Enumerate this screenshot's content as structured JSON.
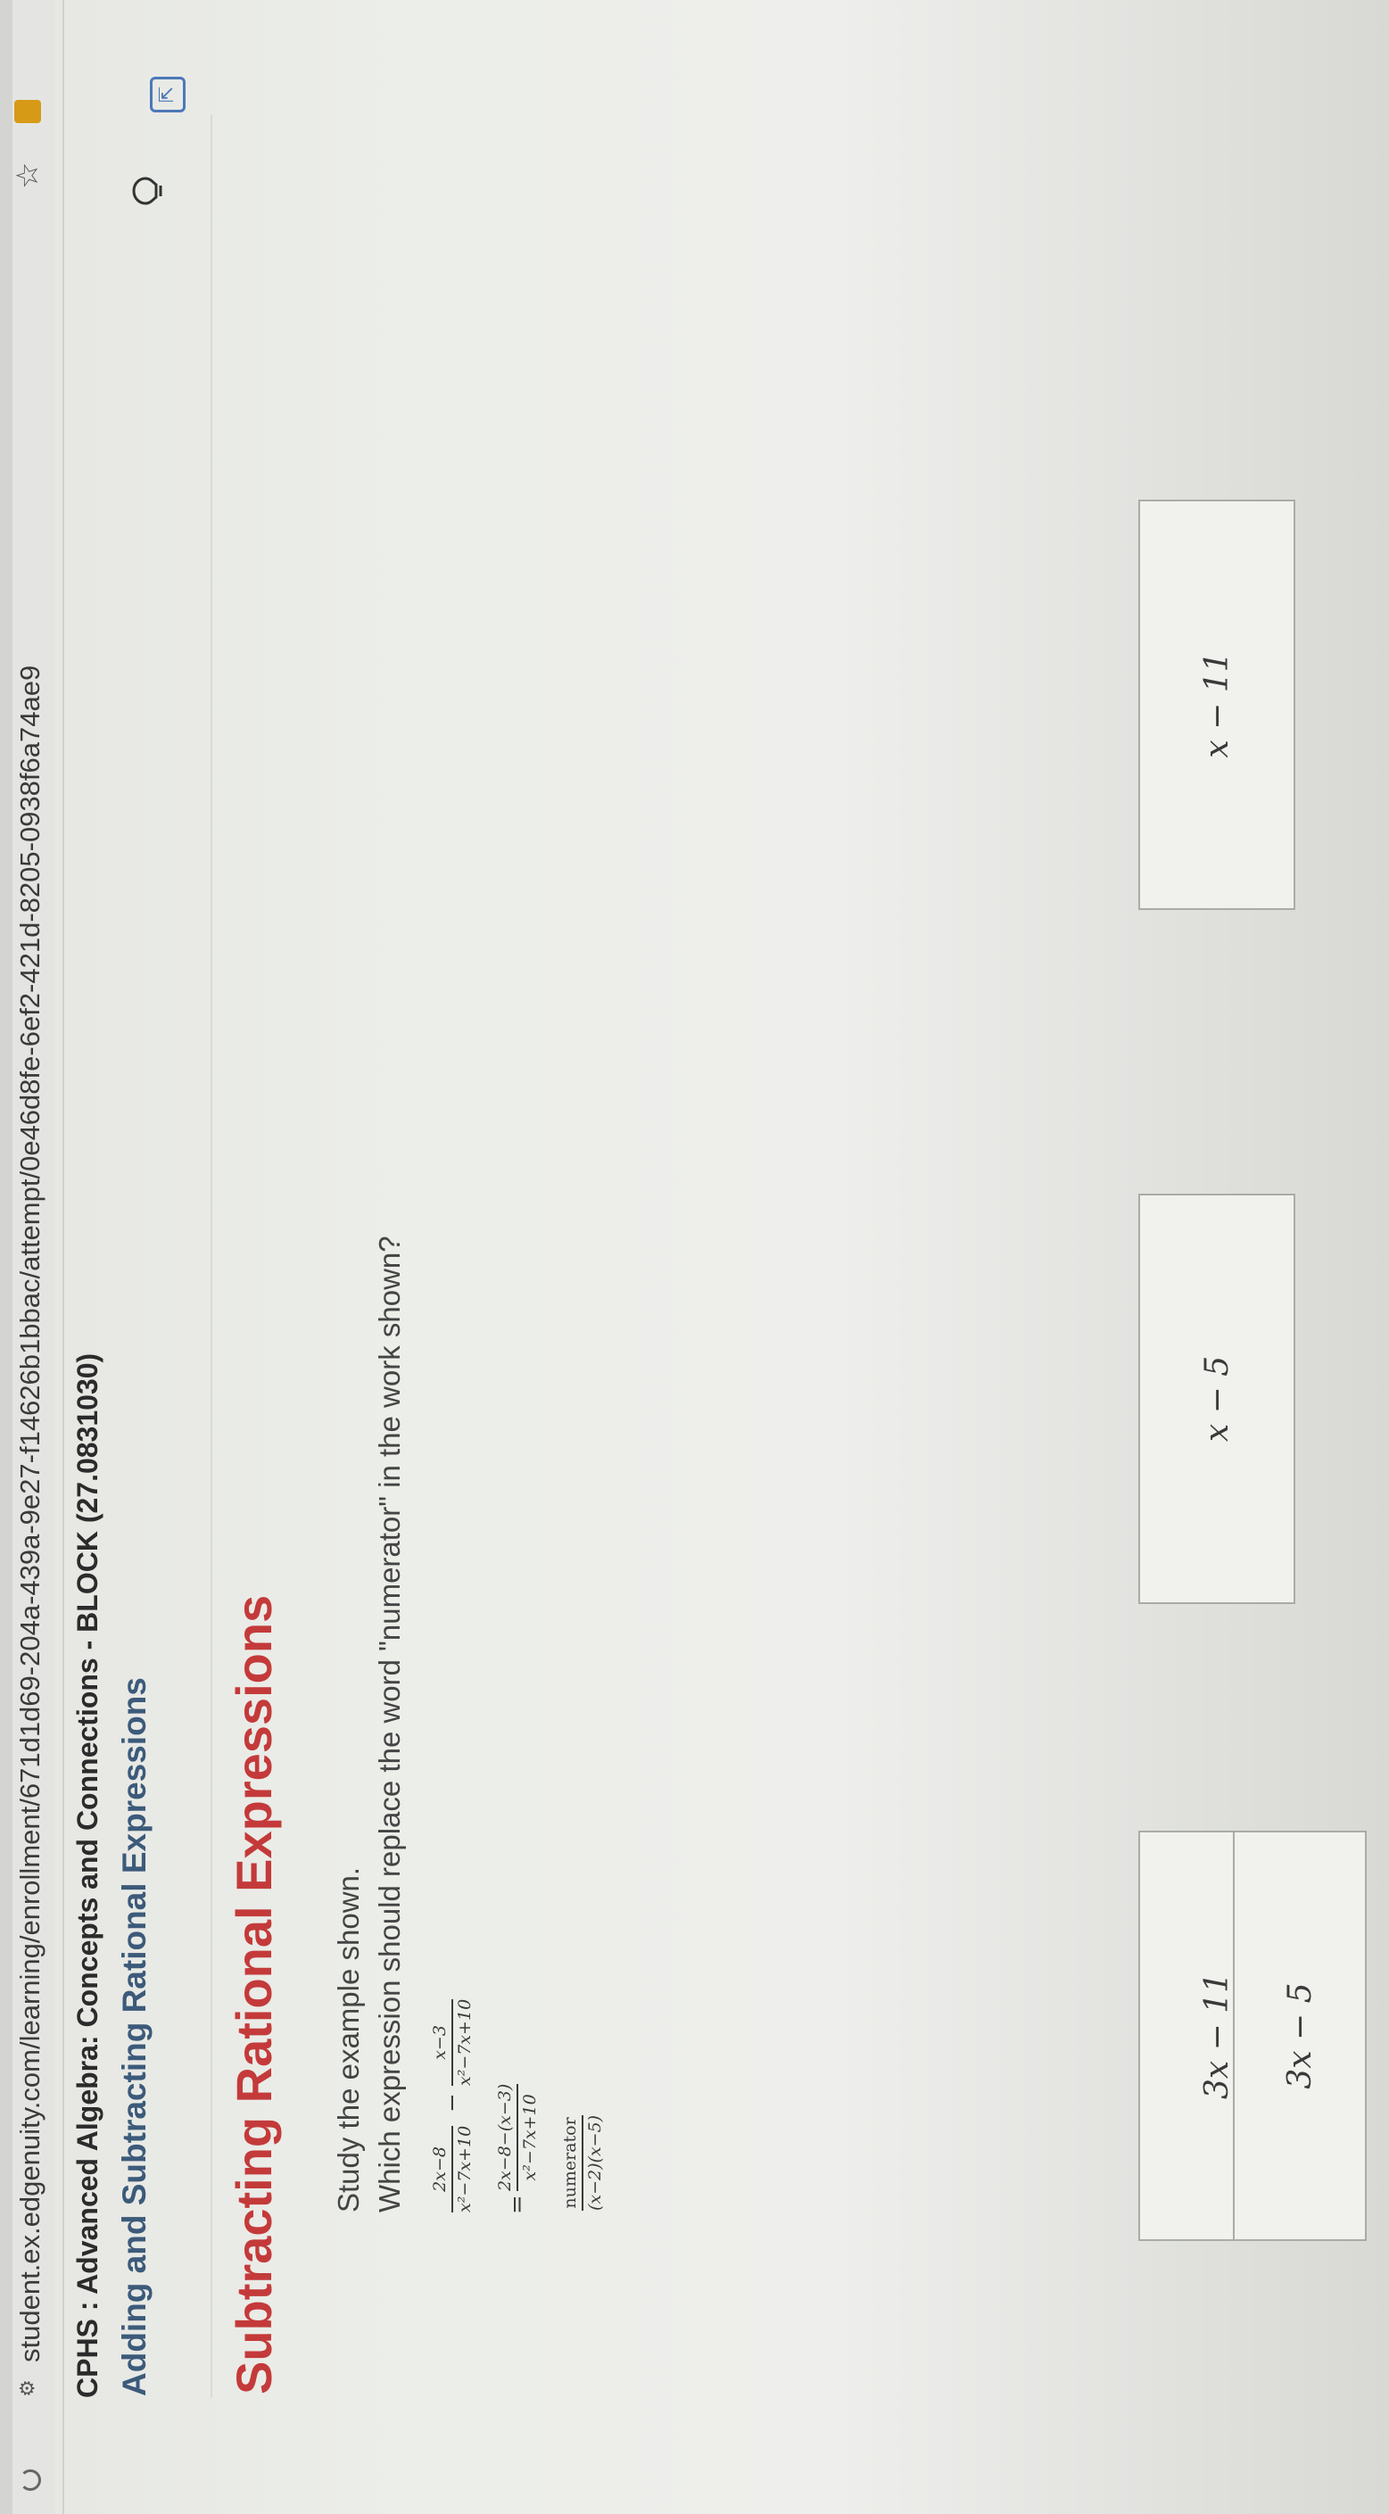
{
  "browser": {
    "url": "student.ex.edgenuity.com/learning/enrollment/671d1d69-204a-439a-9e27-f14626b1bbac/attempt/0e46d8fe-6ef2-421d-8205-0938f6a74ae9"
  },
  "header": {
    "course": "CPHS : Advanced Algebra: Concepts and Connections - BLOCK (27.0831030)",
    "lesson": "Adding and Subtracting Rational Expressions"
  },
  "main": {
    "title": "Subtracting Rational Expressions",
    "instruction": "Study the example shown.",
    "question": "Which expression should replace the word \"numerator\" in the work shown?",
    "work": {
      "line1": {
        "frac1_num": "2x−8",
        "frac1_den": "x²−7x+10",
        "operator": "−",
        "frac2_num": "x−3",
        "frac2_den": "x²−7x+10"
      },
      "line2": {
        "prefix": "=",
        "num": "2x−8−(x−3)",
        "den": "x²−7x+10"
      },
      "line3": {
        "num": "numerator",
        "den": "(x−2)(x−5)"
      }
    },
    "choices": [
      {
        "label": "3x − 11"
      },
      {
        "label": "x − 5"
      },
      {
        "label": "x − 11"
      },
      {
        "label": "3x − 5"
      }
    ]
  },
  "icons": {
    "reload": "reload-icon",
    "site_info": "site-info-icon",
    "bookmark": "star-icon",
    "extension": "extension-icon",
    "help": "help-bulb-icon",
    "expand": "expand-icon"
  }
}
